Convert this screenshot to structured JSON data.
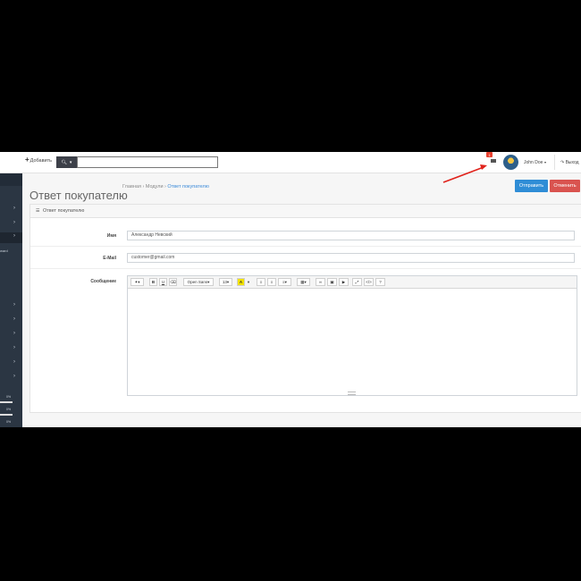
{
  "colors": {
    "sidebar": "#2b3643",
    "send": "#2f8dd6",
    "cancel": "#d9534f",
    "badge": "#e9412f",
    "arrow": "#e0231c"
  },
  "header": {
    "add_label": "Добавить",
    "add_icon": "plus-icon",
    "search_icon": "search-icon",
    "search_value": "",
    "mail_badge": "1",
    "user_name": "John Doe",
    "logout_label": "Выход"
  },
  "page": {
    "title": "Ответ покупателю",
    "breadcrumb": [
      "Главная",
      "Модули",
      "Ответ покупателю"
    ],
    "send_button": "Отправить",
    "cancel_button": "Отменить"
  },
  "panel": {
    "title": "Ответ покупателю",
    "fields": {
      "name": {
        "label": "Имя",
        "value": "Александр Невский"
      },
      "email": {
        "label": "E-Mail",
        "value": "customer@gmail.com"
      },
      "message": {
        "label": "Сообщение",
        "value": ""
      }
    }
  },
  "editor": {
    "font_name": "Open Sans",
    "font_size": "13",
    "buttons": [
      "magic-icon",
      "bold",
      "underline",
      "eraser",
      "font",
      "size",
      "color",
      "ul",
      "ol",
      "align",
      "table",
      "link",
      "picture",
      "video",
      "fullscreen",
      "code",
      "help"
    ]
  },
  "sidebar": {
    "sub_label": "ward",
    "stats": [
      "0%",
      "0%",
      "0%"
    ]
  }
}
